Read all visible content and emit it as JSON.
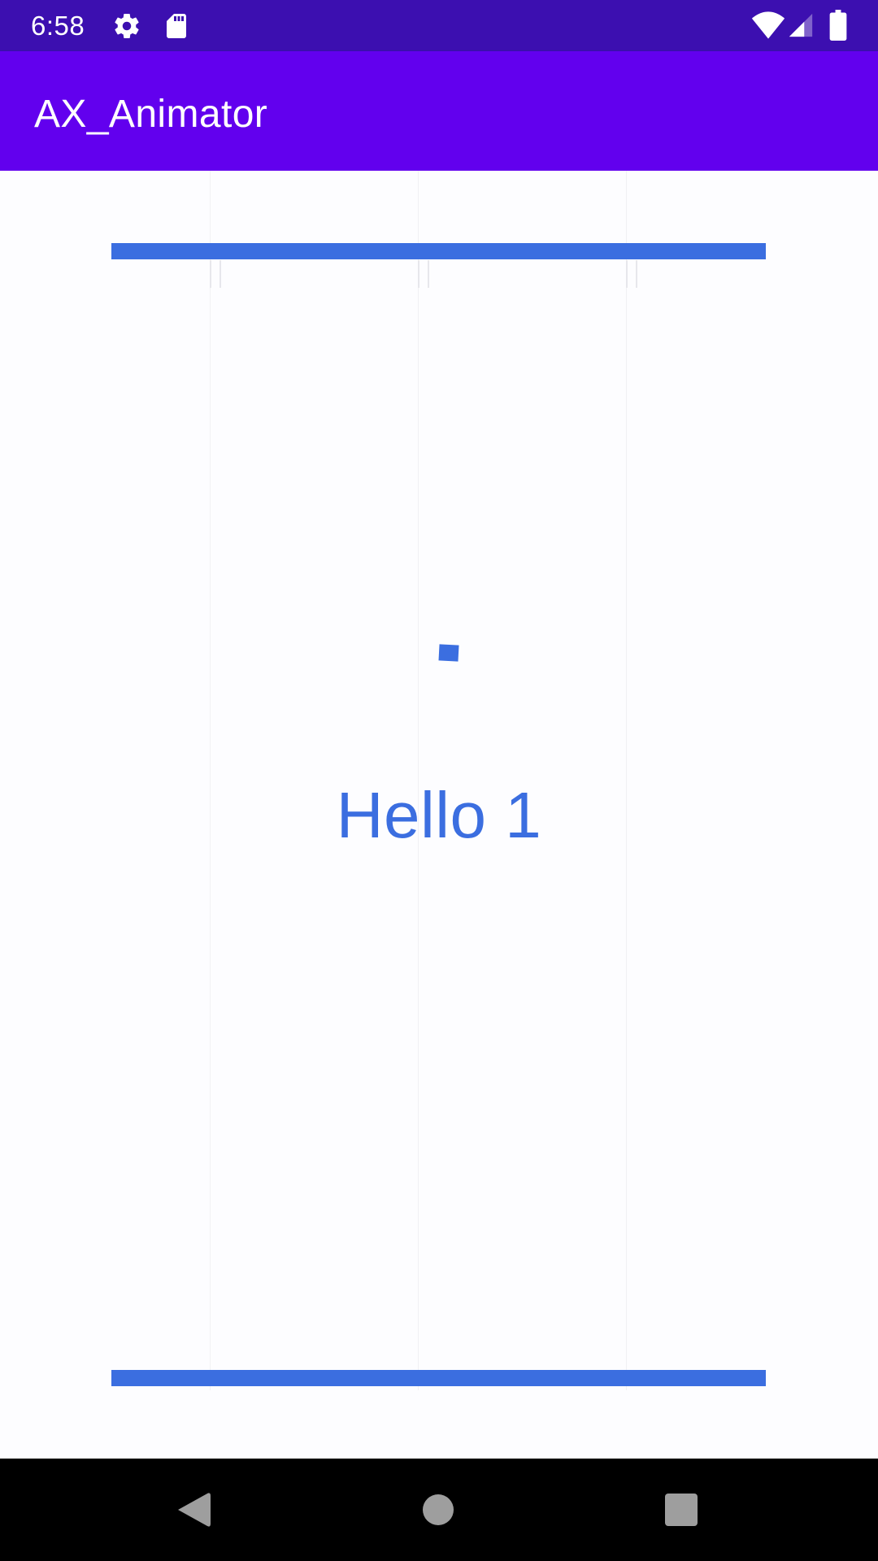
{
  "status_bar": {
    "time": "6:58",
    "background_color": "#3c0fb0",
    "icons": [
      "settings-icon",
      "sd-card-icon",
      "wifi-icon",
      "cell-signal-icon",
      "battery-icon"
    ]
  },
  "app_bar": {
    "title": "AX_Animator",
    "background_color": "#6200ee"
  },
  "content": {
    "label": "Hello 1",
    "accent_color": "#3b6ee0",
    "background_color": "#fdfdff"
  },
  "navigation_bar": {
    "buttons": [
      "back-icon",
      "home-icon",
      "recents-icon"
    ],
    "icon_color": "#9e9e9e"
  }
}
